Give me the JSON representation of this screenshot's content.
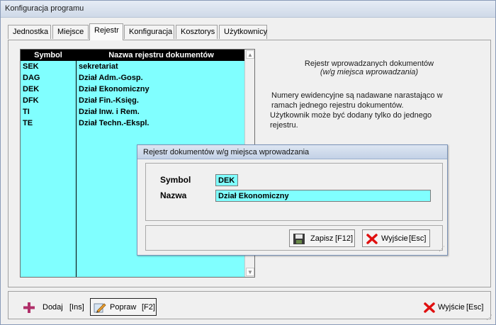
{
  "window": {
    "title": "Konfiguracja programu"
  },
  "tabs": [
    {
      "label": "Jednostka",
      "active": false
    },
    {
      "label": "Miejsce",
      "active": false
    },
    {
      "label": "Rejestr",
      "active": true
    },
    {
      "label": "Konfiguracja",
      "active": false
    },
    {
      "label": "Kosztorys",
      "active": false
    },
    {
      "label": "Użytkownicy",
      "active": false
    }
  ],
  "grid": {
    "headers": {
      "symbol": "Symbol",
      "name": "Nazwa rejestru dokumentów"
    },
    "rows": [
      {
        "symbol": "SEK",
        "name": "sekretariat"
      },
      {
        "symbol": "DAG",
        "name": "Dział Adm.-Gosp."
      },
      {
        "symbol": "DEK",
        "name": "Dział Ekonomiczny"
      },
      {
        "symbol": "DFK",
        "name": "Dział Fin.-Księg."
      },
      {
        "symbol": "TI",
        "name": "Dział Inw. i Rem."
      },
      {
        "symbol": "TE",
        "name": "Dział Techn.-Ekspl."
      }
    ]
  },
  "info": {
    "title": "Rejestr wprowadzanych dokumentów",
    "subtitle": "(w/g miejsca wprowadzania)",
    "line1": "Numery ewidencyjne są nadawane narastająco w",
    "line2": "ramach jednego rejestru dokumentów.",
    "line3": "Użytkownik może być dodany tylko do jednego",
    "line4": "rejestru."
  },
  "dialog": {
    "title": "Rejestr dokumentów w/g miejsca wprowadzania",
    "symbol_label": "Symbol",
    "symbol_value": "DEK",
    "name_label": "Nazwa",
    "name_value": "Dział Ekonomiczny",
    "save_label": "Zapisz",
    "save_key": "[F12]",
    "exit_label": "Wyjście",
    "exit_key": "[Esc]"
  },
  "footer": {
    "add_label": "Dodaj",
    "add_key": "[Ins]",
    "edit_label": "Popraw",
    "edit_key": "[F2]",
    "exit_label": "Wyjście",
    "exit_key": "[Esc]"
  },
  "colors": {
    "grid_bg": "#80ffff",
    "header_bg": "#000000",
    "close_red": "#e01010",
    "plus_magenta": "#b0306a"
  }
}
